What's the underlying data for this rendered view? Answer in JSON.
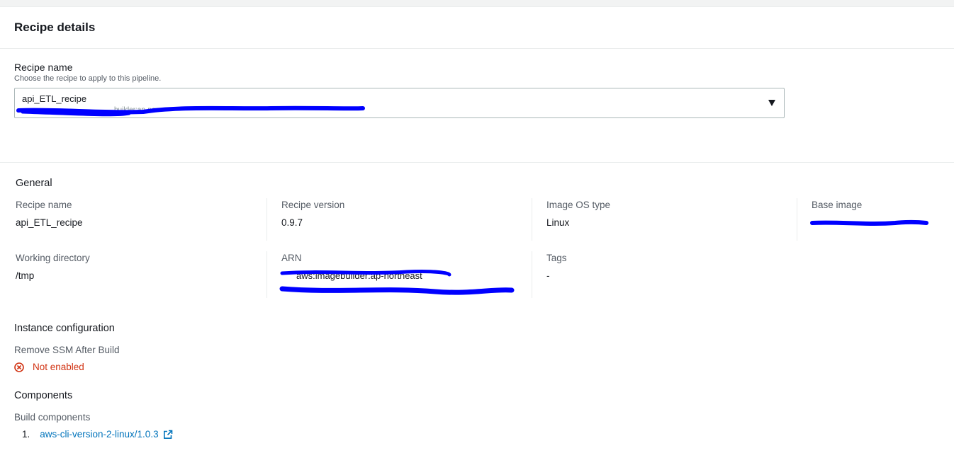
{
  "card": {
    "title": "Recipe details"
  },
  "recipe_field": {
    "label": "Recipe name",
    "description": "Choose the recipe to apply to this pipeline.",
    "selected_value": "api_ETL_recipe",
    "selected_subtext": "builder:ap-no"
  },
  "general": {
    "title": "General",
    "recipe_name_label": "Recipe name",
    "recipe_name_value": "api_ETL_recipe",
    "recipe_version_label": "Recipe version",
    "recipe_version_value": "0.9.7",
    "image_os_label": "Image OS type",
    "image_os_value": "Linux",
    "base_image_label": "Base image",
    "working_dir_label": "Working directory",
    "working_dir_value": "/tmp",
    "arn_label": "ARN",
    "arn_line1": "aws:imagebuilder:ap-northeast",
    "tags_label": "Tags",
    "tags_value": "-"
  },
  "instance_config": {
    "title": "Instance configuration",
    "remove_ssm_label": "Remove SSM After Build",
    "remove_ssm_value": "Not enabled"
  },
  "components": {
    "title": "Components",
    "build_label": "Build components",
    "items": [
      {
        "number": "1.",
        "name": "aws-cli-version-2-linux/1.0.3"
      }
    ]
  },
  "icons": {
    "status": "x-circle-icon",
    "external": "external-link-icon"
  },
  "colors": {
    "link": "#0073bb",
    "error": "#d13212",
    "redaction": "#0000ff"
  }
}
